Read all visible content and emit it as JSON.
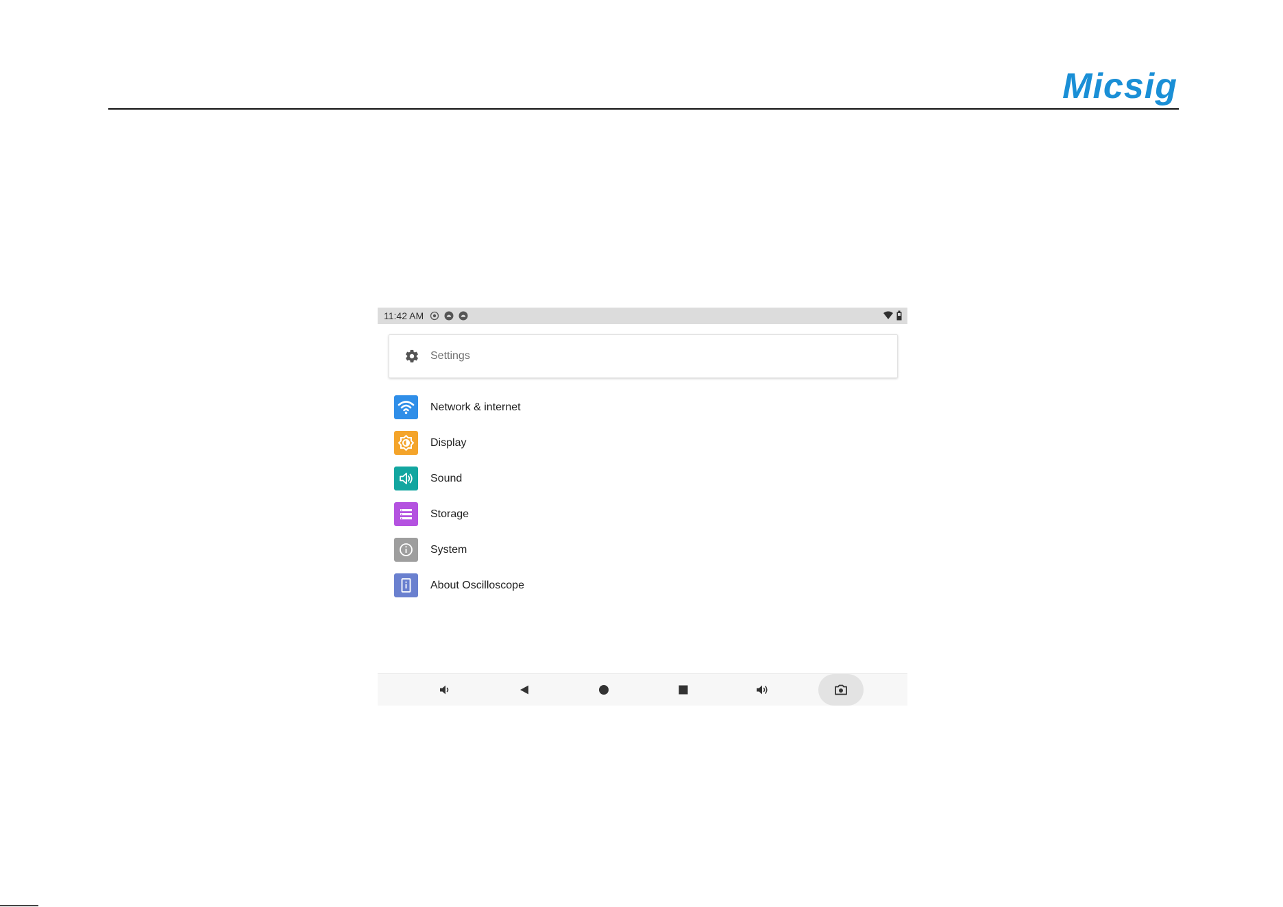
{
  "header": {
    "logo_text": "Micsig",
    "brand_color": "#1a8fd6"
  },
  "statusbar": {
    "time": "11:42 AM",
    "left_icons": [
      "location-icon",
      "android-icon",
      "android-icon"
    ],
    "right_icons": [
      "wifi-icon",
      "battery-icon"
    ]
  },
  "search": {
    "icon": "gear-icon",
    "label": "Settings"
  },
  "settings_items": [
    {
      "label": "Network & internet",
      "icon": "wifi-icon",
      "color": "#2f8ee8"
    },
    {
      "label": "Display",
      "icon": "brightness-icon",
      "color": "#f4a42a"
    },
    {
      "label": "Sound",
      "icon": "volume-icon",
      "color": "#12a6a0"
    },
    {
      "label": "Storage",
      "icon": "storage-icon",
      "color": "#b452e0"
    },
    {
      "label": "System",
      "icon": "info-icon",
      "color": "#9e9e9e"
    },
    {
      "label": "About Oscilloscope",
      "icon": "device-info-icon",
      "color": "#6a80cf"
    }
  ],
  "navbar": {
    "buttons": [
      "volume-down-icon",
      "back-icon",
      "home-icon",
      "recents-icon",
      "volume-up-icon",
      "screenshot-icon"
    ]
  }
}
